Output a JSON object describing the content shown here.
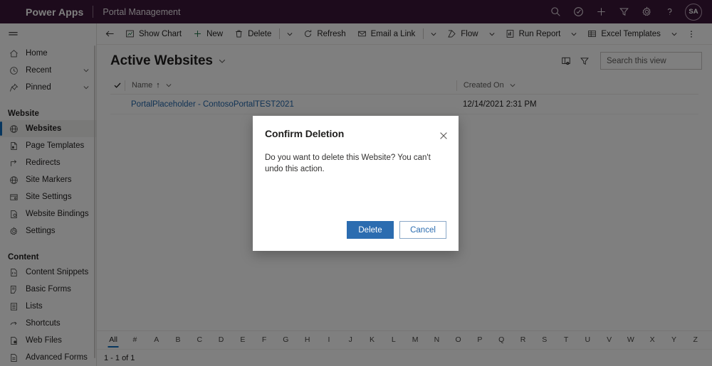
{
  "topbar": {
    "brand": "Power Apps",
    "app_name": "Portal Management",
    "icons": [
      {
        "name": "search-icon",
        "label": "Search"
      },
      {
        "name": "task-circle-icon",
        "label": "Assistant"
      },
      {
        "name": "plus-icon",
        "label": "New"
      },
      {
        "name": "filter-icon",
        "label": "Filter"
      },
      {
        "name": "gear-icon",
        "label": "Settings"
      },
      {
        "name": "help-icon",
        "label": "Help"
      }
    ],
    "avatar_initials": "SA"
  },
  "sidebar": {
    "top_items": [
      {
        "label": "Home",
        "icon": "home-icon",
        "chevron": false
      },
      {
        "label": "Recent",
        "icon": "clock-icon",
        "chevron": true
      },
      {
        "label": "Pinned",
        "icon": "pin-icon",
        "chevron": true
      }
    ],
    "groups": [
      {
        "title": "Website",
        "items": [
          {
            "label": "Websites",
            "icon": "globe-icon",
            "selected": true
          },
          {
            "label": "Page Templates",
            "icon": "page-icon",
            "selected": false
          },
          {
            "label": "Redirects",
            "icon": "redirect-icon",
            "selected": false
          },
          {
            "label": "Site Markers",
            "icon": "globe-icon",
            "selected": false
          },
          {
            "label": "Site Settings",
            "icon": "site-settings-icon",
            "selected": false
          },
          {
            "label": "Website Bindings",
            "icon": "binding-icon",
            "selected": false
          },
          {
            "label": "Settings",
            "icon": "gear-icon",
            "selected": false
          }
        ]
      },
      {
        "title": "Content",
        "items": [
          {
            "label": "Content Snippets",
            "icon": "snippet-icon",
            "selected": false
          },
          {
            "label": "Basic Forms",
            "icon": "form-icon",
            "selected": false
          },
          {
            "label": "Lists",
            "icon": "list-icon",
            "selected": false
          },
          {
            "label": "Shortcuts",
            "icon": "shortcut-icon",
            "selected": false
          },
          {
            "label": "Web Files",
            "icon": "webfile-icon",
            "selected": false
          },
          {
            "label": "Advanced Forms",
            "icon": "advanced-form-icon",
            "selected": false
          }
        ]
      }
    ]
  },
  "commandbar": {
    "back_label": "Back",
    "commands": [
      {
        "label": "Show Chart",
        "icon": "chart-icon",
        "caret": false,
        "divider_after": false
      },
      {
        "label": "New",
        "icon": "plus-icon",
        "caret": false,
        "divider_after": false
      },
      {
        "label": "Delete",
        "icon": "trash-icon",
        "caret": true,
        "divider_after": true
      },
      {
        "label": "Refresh",
        "icon": "refresh-icon",
        "caret": false,
        "divider_after": false
      },
      {
        "label": "Email a Link",
        "icon": "email-icon",
        "caret": true,
        "divider_after": true
      },
      {
        "label": "Flow",
        "icon": "flow-icon",
        "caret": true,
        "divider_after": false
      },
      {
        "label": "Run Report",
        "icon": "report-icon",
        "caret": true,
        "divider_after": false
      },
      {
        "label": "Excel Templates",
        "icon": "excel-icon",
        "caret": true,
        "divider_after": false
      }
    ],
    "overflow_label": "More commands"
  },
  "view": {
    "title": "Active Websites",
    "edit_columns_icon": "edit-columns-icon",
    "edit_filters_icon": "filter-icon",
    "search_placeholder": "Search this view",
    "search_value": ""
  },
  "grid": {
    "columns": [
      {
        "key": "name",
        "label": "Name",
        "sort": "↑"
      },
      {
        "key": "created_on",
        "label": "Created On",
        "sort": ""
      }
    ],
    "rows": [
      {
        "name": "PortalPlaceholder - ContosoPortalTEST2021",
        "created_on": "12/14/2021 2:31 PM"
      }
    ]
  },
  "alphabar": {
    "active": "All",
    "letters": [
      "All",
      "#",
      "A",
      "B",
      "C",
      "D",
      "E",
      "F",
      "G",
      "H",
      "I",
      "J",
      "K",
      "L",
      "M",
      "N",
      "O",
      "P",
      "Q",
      "R",
      "S",
      "T",
      "U",
      "V",
      "W",
      "X",
      "Y",
      "Z"
    ]
  },
  "statusbar": {
    "record_count": "1 - 1 of 1"
  },
  "dialog": {
    "title": "Confirm Deletion",
    "message": "Do you want to delete this Website? You can't undo this action.",
    "close_label": "Close",
    "primary_button": "Delete",
    "secondary_button": "Cancel"
  },
  "colors": {
    "brand_purple": "#3B1638",
    "accent_blue": "#0f6cbd",
    "primary_button": "#2b6cb0",
    "link": "#2266aa"
  }
}
